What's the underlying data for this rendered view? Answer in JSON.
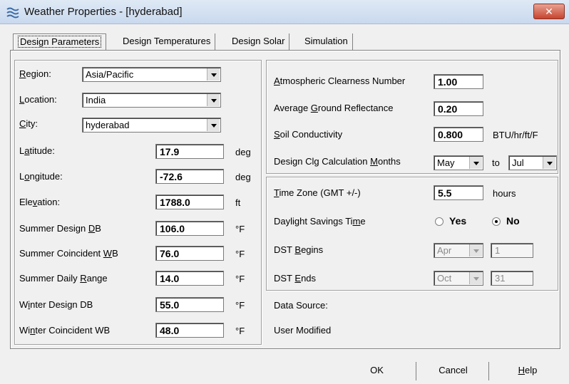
{
  "window": {
    "title": "Weather Properties - [hyderabad]",
    "close_label": "✕"
  },
  "tabs": [
    {
      "label": "Design Parameters",
      "active": true
    },
    {
      "label": "Design Temperatures"
    },
    {
      "label": "Design Solar"
    },
    {
      "label": "Simulation"
    }
  ],
  "left": {
    "region": {
      "pre": "",
      "key": "R",
      "post": "egion:",
      "value": "Asia/Pacific"
    },
    "location": {
      "pre": "",
      "key": "L",
      "post": "ocation:",
      "value": "India"
    },
    "city": {
      "pre": "",
      "key": "C",
      "post": "ity:",
      "value": "hyderabad"
    },
    "latitude": {
      "pre": "L",
      "key": "a",
      "post": "titude:",
      "value": "17.9",
      "unit": "deg"
    },
    "longitude": {
      "pre": "L",
      "key": "o",
      "post": "ngitude:",
      "value": "-72.6",
      "unit": "deg"
    },
    "elevation": {
      "pre": "Ele",
      "key": "v",
      "post": "ation:",
      "value": "1788.0",
      "unit": "ft"
    },
    "summer_db": {
      "pre": "Summer Design ",
      "key": "D",
      "post": "B",
      "value": "106.0",
      "unit": "°F"
    },
    "summer_wb": {
      "pre": "Summer Coincident ",
      "key": "W",
      "post": "B",
      "value": "76.0",
      "unit": "°F"
    },
    "summer_range": {
      "pre": "Summer Daily ",
      "key": "R",
      "post": "ange",
      "value": "14.0",
      "unit": "°F"
    },
    "winter_db": {
      "pre": "W",
      "key": "i",
      "post": "nter Design DB",
      "value": "55.0",
      "unit": "°F"
    },
    "winter_wb": {
      "pre": "Wi",
      "key": "n",
      "post": "ter Coincident WB",
      "value": "48.0",
      "unit": "°F"
    }
  },
  "right": {
    "clearness": {
      "pre": "",
      "key": "A",
      "post": "tmospheric Clearness Number",
      "value": "1.00"
    },
    "reflectance": {
      "pre": "Average ",
      "key": "G",
      "post": "round Reflectance",
      "value": "0.20"
    },
    "soil": {
      "pre": "",
      "key": "S",
      "post": "oil Conductivity",
      "value": "0.800",
      "unit": "BTU/hr/ft/F"
    },
    "months": {
      "pre": "Design Clg Calculation ",
      "key": "M",
      "post": "onths",
      "from": "May",
      "to_label": "to",
      "to": "Jul"
    },
    "timezone": {
      "pre": "",
      "key": "T",
      "post": "ime Zone (GMT +/-)",
      "value": "5.5",
      "unit": "hours"
    },
    "dst": {
      "pre": "Daylight Savings Ti",
      "key": "m",
      "post": "e",
      "yes": "Yes",
      "no": "No",
      "selected": "No"
    },
    "dst_begins": {
      "pre": "DST ",
      "key": "B",
      "post": "egins",
      "month": "Apr",
      "day": "1"
    },
    "dst_ends": {
      "pre": "DST ",
      "key": "E",
      "post": "nds",
      "month": "Oct",
      "day": "31"
    },
    "data_source": "Data Source:",
    "user_modified": "User Modified"
  },
  "buttons": {
    "ok": "OK",
    "cancel": "Cancel",
    "help_key": "H",
    "help_post": "elp"
  }
}
